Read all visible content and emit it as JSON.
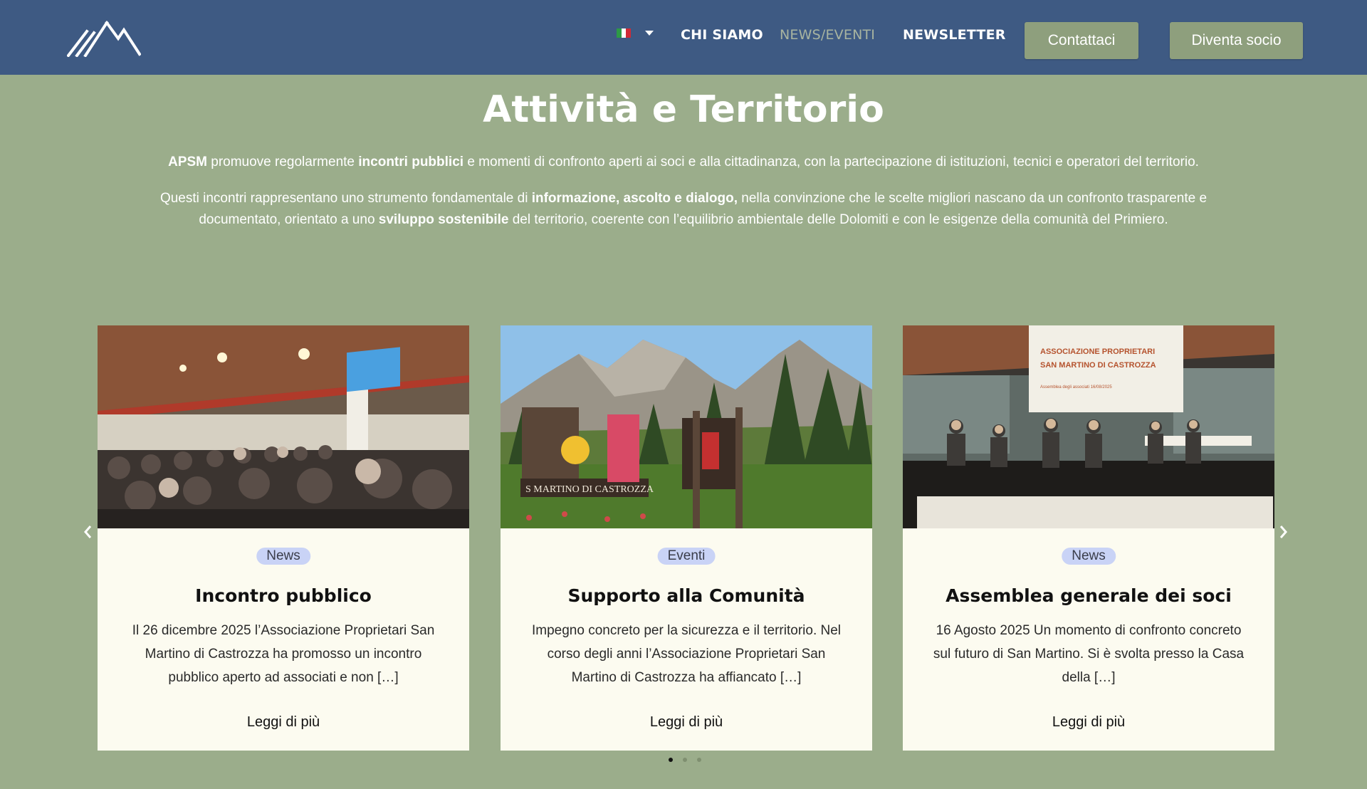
{
  "header": {
    "logo_name": "mountain-logo",
    "language": {
      "flag_colors": [
        "#2d9a46",
        "#ffffff",
        "#cf2b37"
      ],
      "current": "it"
    },
    "nav": {
      "chi_siamo": "CHI SIAMO",
      "news_eventi": "NEWS/EVENTI",
      "newsletter": "NEWSLETTER"
    },
    "buttons": {
      "contact": "Contattaci",
      "join": "Diventa socio"
    }
  },
  "intro": {
    "title": "Attività e Territorio",
    "p1": {
      "a": "APSM",
      "b": " promuove regolarmente ",
      "c": "incontri pubblici",
      "d": " e momenti di confronto aperti ai soci e alla cittadinanza, con la partecipazione di istituzioni, tecnici e operatori del territorio."
    },
    "p2": {
      "a": "Questi incontri rappresentano uno strumento fondamentale di ",
      "b": "informazione, ascolto e dialogo,",
      "c": " nella convinzione che le scelte migliori nascano da un confronto trasparente e documentato, orientato a uno ",
      "d": "sviluppo sostenibile",
      "e": " del territorio, coerente con l’equilibrio ambientale delle Dolomiti e con le esigenze della comunità del Primiero."
    }
  },
  "cards": [
    {
      "tag": "News",
      "title": "Incontro pubblico",
      "text": "Il 26 dicembre 2025 l’Associazione Proprietari San Martino di Castrozza ha promosso un incontro pubblico aperto ad associati e non […]",
      "link": "Leggi di più"
    },
    {
      "tag": "Eventi",
      "title": "Supporto alla Comunità",
      "text": "Impegno concreto per la sicurezza e il territorio. Nel corso degli anni l’Associazione Proprietari San Martino di Castrozza ha affiancato […]",
      "link": "Leggi di più",
      "sign_text": "S MARTINO DI CASTROZZA"
    },
    {
      "tag": "News",
      "title": "Assemblea generale dei soci",
      "text": "16 Agosto 2025 Un momento di confronto concreto sul futuro di San Martino. Si è svolta presso la Casa della […]",
      "link": "Leggi di più",
      "screen_line1": "ASSOCIAZIONE PROPRIETARI",
      "screen_line2": "SAN MARTINO DI CASTROZZA",
      "screen_line3": "Assemblea degli associati 16/08/2025"
    }
  ],
  "carousel": {
    "pages": 3,
    "active_page": 1
  },
  "colors": {
    "header_bg": "#3e5a83",
    "page_bg": "#9bad8b",
    "button_bg": "#8e9f7d",
    "card_bg": "#fcfbf0",
    "tag_bg": "#c9d3f6"
  }
}
